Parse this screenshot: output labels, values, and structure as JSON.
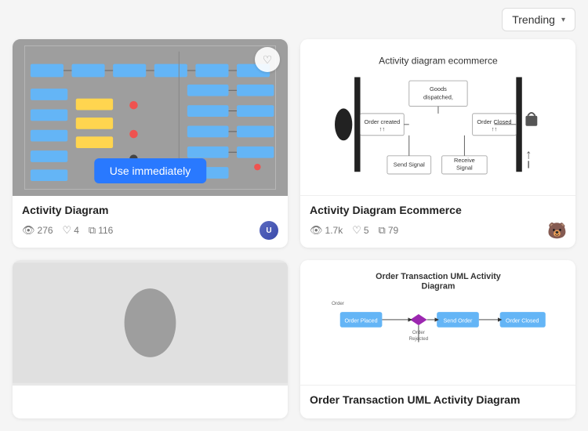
{
  "topbar": {
    "dropdown_label": "Trending",
    "chevron": "▾"
  },
  "cards": [
    {
      "id": "activity-diagram",
      "title": "Activity Diagram",
      "views": "276",
      "likes": "4",
      "copies": "116",
      "use_btn_label": "Use immediately",
      "thumbnail_type": "activity-flowchart",
      "avatar_type": "user-photo"
    },
    {
      "id": "activity-diagram-ecommerce",
      "title": "Activity Diagram Ecommerce",
      "views": "1.7k",
      "likes": "5",
      "copies": "79",
      "thumbnail_type": "ecommerce-diagram",
      "avatar_type": "emoji-avatar",
      "avatar_emoji": "🐻"
    },
    {
      "id": "bottom-left",
      "title": "",
      "views": "",
      "likes": "",
      "copies": "",
      "thumbnail_type": "circle-shape"
    },
    {
      "id": "order-transaction-uml",
      "title": "Order Transaction UML Activity Diagram",
      "views": "",
      "likes": "",
      "copies": "",
      "thumbnail_type": "order-uml"
    }
  ],
  "icons": {
    "eye": "👁",
    "heart": "♡",
    "copy": "⧉",
    "heart_filled": "♡"
  }
}
